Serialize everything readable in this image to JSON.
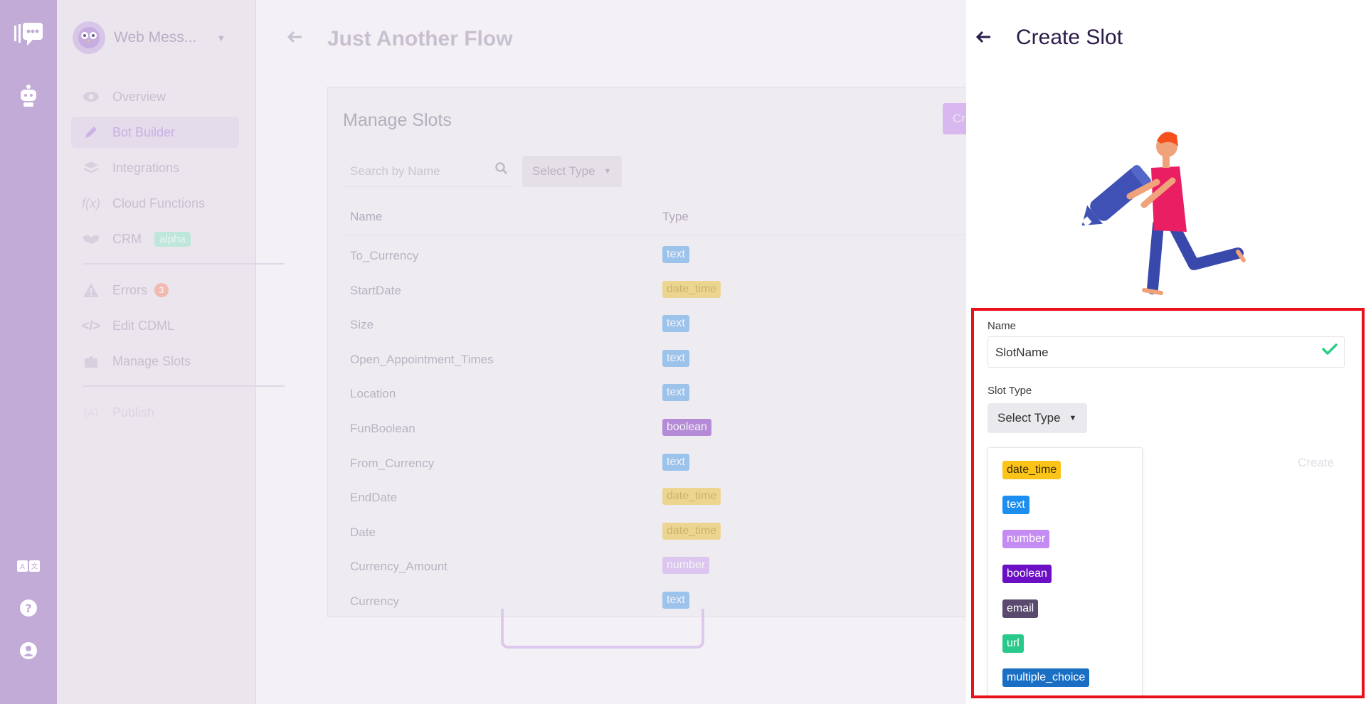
{
  "nav": {
    "brand_name": "Web Mess...",
    "items": [
      {
        "label": "Overview"
      },
      {
        "label": "Bot Builder"
      },
      {
        "label": "Integrations"
      },
      {
        "label": "Cloud Functions"
      },
      {
        "label": "CRM",
        "badge": "alpha"
      },
      {
        "label": "Errors",
        "badge": "3"
      },
      {
        "label": "Edit CDML"
      },
      {
        "label": "Manage Slots"
      },
      {
        "label": "Publish"
      }
    ]
  },
  "page": {
    "title": "Just Another Flow"
  },
  "manage_slots": {
    "title": "Manage Slots",
    "create_label": "Cr",
    "search_placeholder": "Search by Name",
    "type_filter_label": "Select Type",
    "columns": {
      "name": "Name",
      "type": "Type"
    },
    "rows": [
      {
        "name": "To_Currency",
        "type": "text"
      },
      {
        "name": "StartDate",
        "type": "date_time"
      },
      {
        "name": "Size",
        "type": "text"
      },
      {
        "name": "Open_Appointment_Times",
        "type": "text"
      },
      {
        "name": "Location",
        "type": "text"
      },
      {
        "name": "FunBoolean",
        "type": "boolean"
      },
      {
        "name": "From_Currency",
        "type": "text"
      },
      {
        "name": "EndDate",
        "type": "date_time"
      },
      {
        "name": "Date",
        "type": "date_time"
      },
      {
        "name": "Currency_Amount",
        "type": "number"
      },
      {
        "name": "Currency",
        "type": "text"
      }
    ]
  },
  "panel": {
    "title": "Create Slot",
    "name_label": "Name",
    "name_value": "SlotName",
    "slot_type_label": "Slot Type",
    "slot_type_button": "Select Type",
    "create_label": "Create",
    "type_options": [
      {
        "label": "date_time",
        "color": "#fcc419",
        "text_color": "#3a2e00"
      },
      {
        "label": "text",
        "color": "#1c8ef0",
        "text_color": "#ffffff"
      },
      {
        "label": "number",
        "color": "#c48cf2",
        "text_color": "#ffffff"
      },
      {
        "label": "boolean",
        "color": "#6b0fc4",
        "text_color": "#ffffff"
      },
      {
        "label": "email",
        "color": "#5a4a6e",
        "text_color": "#ffffff"
      },
      {
        "label": "url",
        "color": "#28c98a",
        "text_color": "#ffffff"
      },
      {
        "label": "multiple_choice",
        "color": "#1a6fc4",
        "text_color": "#ffffff"
      }
    ]
  },
  "type_colors": {
    "text": "#9cc3ec",
    "date_time": "#ecd591",
    "boolean": "#b58ad6",
    "number": "#dcc6ef"
  }
}
